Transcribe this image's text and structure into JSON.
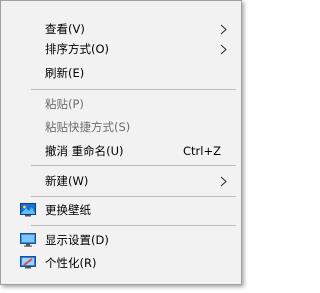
{
  "menu": {
    "items": [
      {
        "label": "查看(V)"
      },
      {
        "label": "排序方式(O)"
      },
      {
        "label": "刷新(E)"
      },
      {
        "label": "粘贴(P)"
      },
      {
        "label": "粘贴快捷方式(S)"
      },
      {
        "label": "撤消 重命名(U)",
        "shortcut": "Ctrl+Z"
      },
      {
        "label": "新建(W)"
      },
      {
        "label": "更换壁纸",
        "icon": "wallpaper-icon"
      },
      {
        "label": "显示设置(D)",
        "icon": "display-settings-icon"
      },
      {
        "label": "个性化(R)",
        "icon": "personalize-icon"
      }
    ]
  },
  "colors": {
    "menu_background": "#f2f2f2",
    "border": "#a0a0a0",
    "disabled_text": "#6d6d6d",
    "separator": "#bdbdbd"
  }
}
